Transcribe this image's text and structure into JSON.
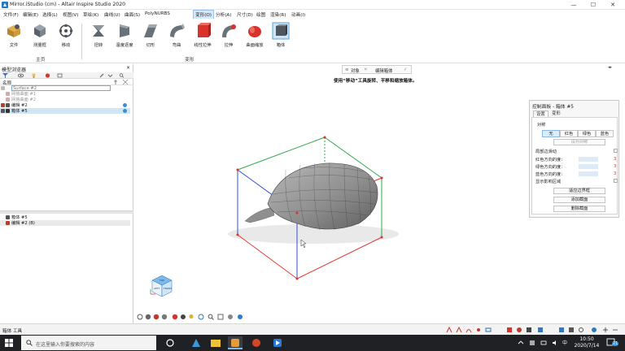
{
  "window": {
    "title": "Mirror.iStudio (cm) - Altair Inspire Studio 2020",
    "controls": [
      "—",
      "☐",
      "✕"
    ]
  },
  "menu": [
    "文件(F)",
    "编辑(E)",
    "选择(L)",
    "视图(V)",
    "草绘(K)",
    "曲线(U)",
    "曲面(S)",
    "PolyNURBS",
    "变形(O)",
    "分析(A)",
    "尺寸(D)",
    "绘图",
    "渲染(R)",
    "动画(I)"
  ],
  "menu_active": "变形(O)",
  "ribbon": {
    "home_tools": [
      "文件",
      "测量框",
      "移动"
    ],
    "home_group": "主页",
    "deform_tools": [
      "扭转",
      "温度逐度",
      "切形",
      "弯曲",
      "线性拉伸",
      "拉伸",
      "曲面缩放",
      "箱体"
    ],
    "deform_group": "变形"
  },
  "browser": {
    "title": "模型浏览器",
    "column_name": "名称",
    "rename_value": "Surface #2",
    "items": [
      {
        "label": "网格曲面 #1",
        "state": "dim"
      },
      {
        "label": "网格曲面 #2",
        "state": "dim"
      },
      {
        "label": "编辑 #2",
        "state": "normal"
      },
      {
        "label": "箱体 #5",
        "state": "selected"
      }
    ],
    "history": [
      "箱体 #5",
      "编辑 #2 (B)"
    ]
  },
  "context_bar": {
    "object": "对象",
    "edit": "编辑箱体"
  },
  "hint": "使用“移动”工具旋转、平移和缩放箱体。",
  "control_panel": {
    "title": "控制面板 - 箱体 #5",
    "tabs": [
      "设置",
      "变形"
    ],
    "symmetry_label": "对称",
    "symmetry_options": [
      "无",
      "红色",
      "绿色",
      "蓝色"
    ],
    "symmetry_selected": "无",
    "set_symmetric": "设为对称",
    "local_slide": "局部边滑动",
    "red_degree_label": "红色方向的度：",
    "red_degree": "3",
    "green_degree_label": "绿色方向的度：",
    "green_degree": "3",
    "blue_degree_label": "蓝色方向的度：",
    "blue_degree": "3",
    "show_region": "显示影响区域",
    "buttons": [
      "适应边界框",
      "添加截面",
      "删除截面"
    ]
  },
  "cube_labels": {
    "top": "TOP",
    "left": "LEFT",
    "front": "FRONT"
  },
  "statusbar": {
    "text": "箱体 工具"
  },
  "taskbar": {
    "search_placeholder": "在这里输入你要搜索的内容",
    "time": "10:50",
    "date": "2020/7/14",
    "notif_count": "21"
  },
  "colors": {
    "accent": "#3b8fd8",
    "red_axis": "#e03c31",
    "green_axis": "#2ea84a",
    "blue_axis": "#2f4fd8",
    "surface": "#8a8a8a"
  }
}
